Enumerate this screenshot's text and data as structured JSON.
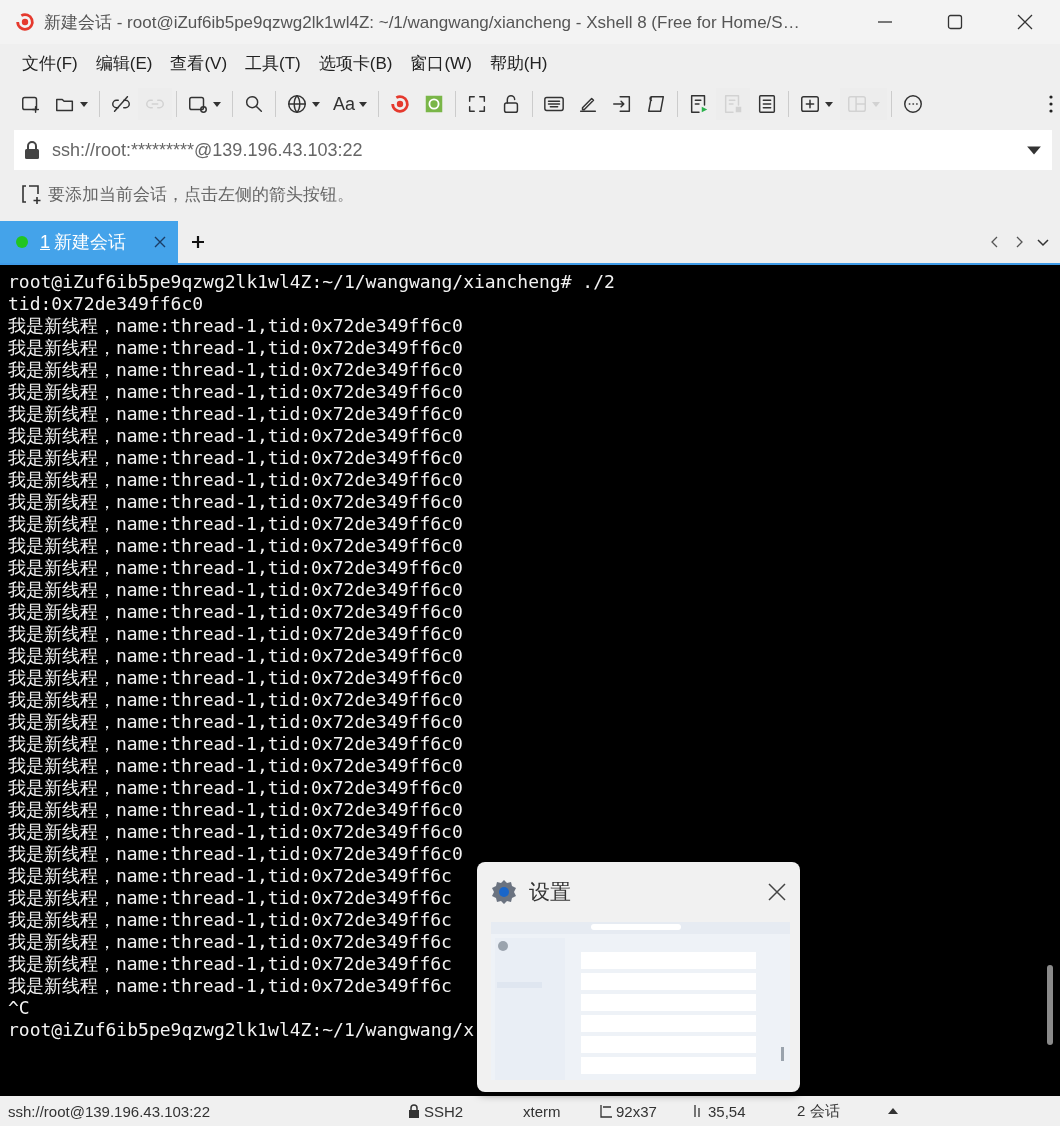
{
  "window": {
    "title": "新建会话 - root@iZuf6ib5pe9qzwg2lk1wl4Z: ~/1/wangwang/xiancheng - Xshell 8 (Free for Home/S…"
  },
  "menu": [
    "文件(F)",
    "编辑(E)",
    "查看(V)",
    "工具(T)",
    "选项卡(B)",
    "窗口(W)",
    "帮助(H)"
  ],
  "toolbar": [
    {
      "disabled": false,
      "dropdown": false
    },
    {
      "disabled": false,
      "dropdown": true
    },
    {
      "disabled": false,
      "dropdown": false
    },
    {
      "disabled": true,
      "dropdown": false
    },
    {
      "disabled": false,
      "dropdown": true
    },
    {
      "disabled": false,
      "dropdown": false
    },
    {
      "disabled": false,
      "dropdown": true
    },
    {
      "disabled": false,
      "dropdown": true,
      "label": "Aa"
    },
    {
      "disabled": false,
      "dropdown": false
    },
    {
      "disabled": false,
      "dropdown": false
    },
    {
      "disabled": false,
      "dropdown": false
    },
    {
      "disabled": false,
      "dropdown": false
    },
    {
      "disabled": false,
      "dropdown": false
    },
    {
      "disabled": false,
      "dropdown": false
    },
    {
      "disabled": false,
      "dropdown": false
    },
    {
      "disabled": false,
      "dropdown": false
    },
    {
      "disabled": false,
      "dropdown": false
    },
    {
      "disabled": true,
      "dropdown": false
    },
    {
      "disabled": false,
      "dropdown": false
    },
    {
      "disabled": false,
      "dropdown": true
    },
    {
      "disabled": true,
      "dropdown": true
    },
    {
      "disabled": false,
      "dropdown": false
    }
  ],
  "address": {
    "value": "ssh://root:*********@139.196.43.103:22"
  },
  "hint": "要添加当前会话，点击左侧的箭头按钮。",
  "tabs": [
    {
      "number": "1",
      "label": "新建会话",
      "selected": true,
      "color": "#22c522"
    }
  ],
  "terminal": {
    "lines": [
      "root@iZuf6ib5pe9qzwg2lk1wl4Z:~/1/wangwang/xiancheng# ./2",
      "tid:0x72de349ff6c0",
      "我是新线程，name:thread-1,tid:0x72de349ff6c0",
      "我是新线程，name:thread-1,tid:0x72de349ff6c0",
      "我是新线程，name:thread-1,tid:0x72de349ff6c0",
      "我是新线程，name:thread-1,tid:0x72de349ff6c0",
      "我是新线程，name:thread-1,tid:0x72de349ff6c0",
      "我是新线程，name:thread-1,tid:0x72de349ff6c0",
      "我是新线程，name:thread-1,tid:0x72de349ff6c0",
      "我是新线程，name:thread-1,tid:0x72de349ff6c0",
      "我是新线程，name:thread-1,tid:0x72de349ff6c0",
      "我是新线程，name:thread-1,tid:0x72de349ff6c0",
      "我是新线程，name:thread-1,tid:0x72de349ff6c0",
      "我是新线程，name:thread-1,tid:0x72de349ff6c0",
      "我是新线程，name:thread-1,tid:0x72de349ff6c0",
      "我是新线程，name:thread-1,tid:0x72de349ff6c0",
      "我是新线程，name:thread-1,tid:0x72de349ff6c0",
      "我是新线程，name:thread-1,tid:0x72de349ff6c0",
      "我是新线程，name:thread-1,tid:0x72de349ff6c0",
      "我是新线程，name:thread-1,tid:0x72de349ff6c0",
      "我是新线程，name:thread-1,tid:0x72de349ff6c0",
      "我是新线程，name:thread-1,tid:0x72de349ff6c0",
      "我是新线程，name:thread-1,tid:0x72de349ff6c0",
      "我是新线程，name:thread-1,tid:0x72de349ff6c0",
      "我是新线程，name:thread-1,tid:0x72de349ff6c0",
      "我是新线程，name:thread-1,tid:0x72de349ff6c0",
      "我是新线程，name:thread-1,tid:0x72de349ff6c0",
      "我是新线程，name:thread-1,tid:0x72de349ff6c",
      "我是新线程，name:thread-1,tid:0x72de349ff6c",
      "我是新线程，name:thread-1,tid:0x72de349ff6c",
      "我是新线程，name:thread-1,tid:0x72de349ff6c",
      "我是新线程，name:thread-1,tid:0x72de349ff6c",
      "我是新线程，name:thread-1,tid:0x72de349ff6c",
      "^C",
      "root@iZuf6ib5pe9qzwg2lk1wl4Z:~/1/wangwang/x"
    ]
  },
  "popup": {
    "title": "设置"
  },
  "status_bar": {
    "address": "ssh://root@139.196.43.103:22",
    "protocol": "SSH2",
    "terminal_type": "xterm",
    "size": "92x37",
    "cursor": "35,54",
    "sessions": "2 会话"
  }
}
